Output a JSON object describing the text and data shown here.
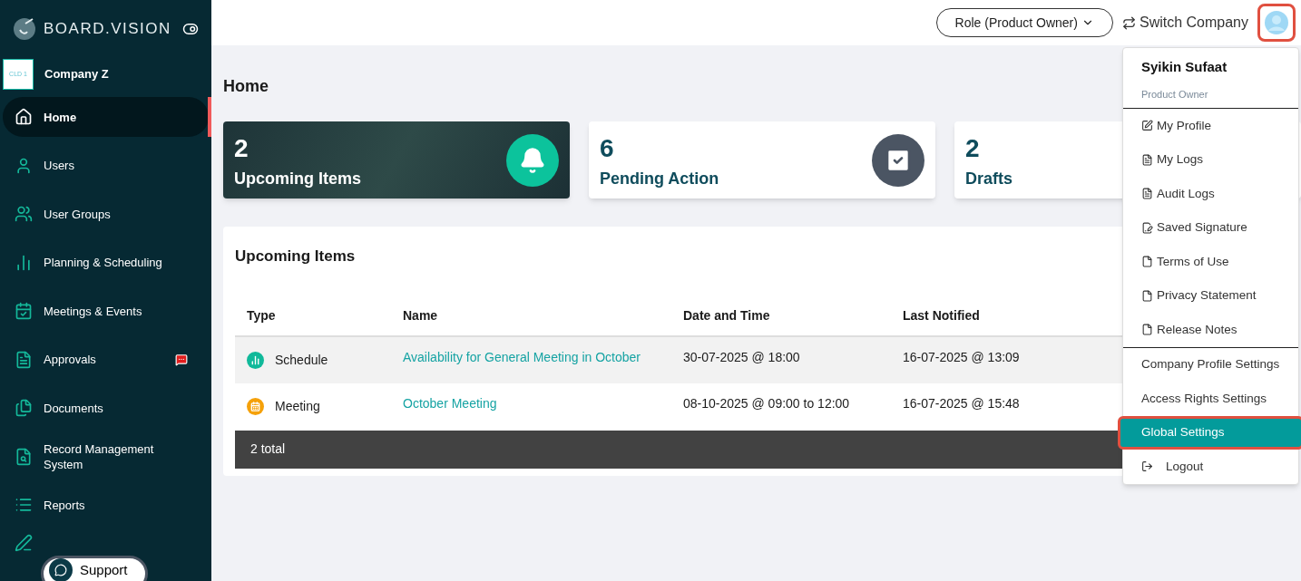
{
  "brand": {
    "name": "BOARD.VISION"
  },
  "company": {
    "logo_text": "CLD 1",
    "name": "Company Z"
  },
  "sidebar": {
    "items": [
      {
        "label": "Home",
        "selected": true,
        "badge": false
      },
      {
        "label": "Users",
        "selected": false,
        "badge": false
      },
      {
        "label": "User Groups",
        "selected": false,
        "badge": false
      },
      {
        "label": "Planning & Scheduling",
        "selected": false,
        "badge": false
      },
      {
        "label": "Meetings & Events",
        "selected": false,
        "badge": false
      },
      {
        "label": "Approvals",
        "selected": false,
        "badge": true
      },
      {
        "label": "Documents",
        "selected": false,
        "badge": false
      },
      {
        "label": "Record Management System",
        "selected": false,
        "badge": false
      },
      {
        "label": "Reports",
        "selected": false,
        "badge": false
      }
    ]
  },
  "support": {
    "label": "Support"
  },
  "header": {
    "role": "Role (Product Owner)",
    "switch_company": "Switch Company"
  },
  "page_title": "Home",
  "stats": [
    {
      "count": "2",
      "label": "Upcoming Items",
      "kind": "dark"
    },
    {
      "count": "6",
      "label": "Pending Action",
      "kind": "light"
    },
    {
      "count": "2",
      "label": "Drafts",
      "kind": "light"
    }
  ],
  "table": {
    "title": "Upcoming Items",
    "columns": [
      "Type",
      "Name",
      "Date and Time",
      "Last Notified"
    ],
    "rows": [
      {
        "type": "Schedule",
        "name": "Availability for General Meeting in October",
        "date": "30-07-2025 @ 18:00",
        "last_notified": "16-07-2025 @ 13:09"
      },
      {
        "type": "Meeting",
        "name": "October Meeting",
        "date": "08-10-2025 @ 09:00 to 12:00",
        "last_notified": "16-07-2025 @ 15:48"
      }
    ],
    "footer": "2 total"
  },
  "user_menu": {
    "name": "Syikin Sufaat",
    "role": "Product Owner",
    "groups": [
      {
        "items": [
          {
            "label": "My Profile",
            "selected": false
          },
          {
            "label": "My Logs",
            "selected": false
          },
          {
            "label": "Audit Logs",
            "selected": false
          },
          {
            "label": "Saved Signature",
            "selected": false
          },
          {
            "label": "Terms of Use",
            "selected": false
          },
          {
            "label": "Privacy Statement",
            "selected": false
          },
          {
            "label": "Release Notes",
            "selected": false
          }
        ]
      },
      {
        "items": [
          {
            "label": "Company Profile Settings",
            "selected": false
          },
          {
            "label": "Access Rights Settings",
            "selected": false
          },
          {
            "label": "Global Settings",
            "selected": true
          },
          {
            "label": "Logout",
            "selected": false
          }
        ]
      }
    ]
  }
}
